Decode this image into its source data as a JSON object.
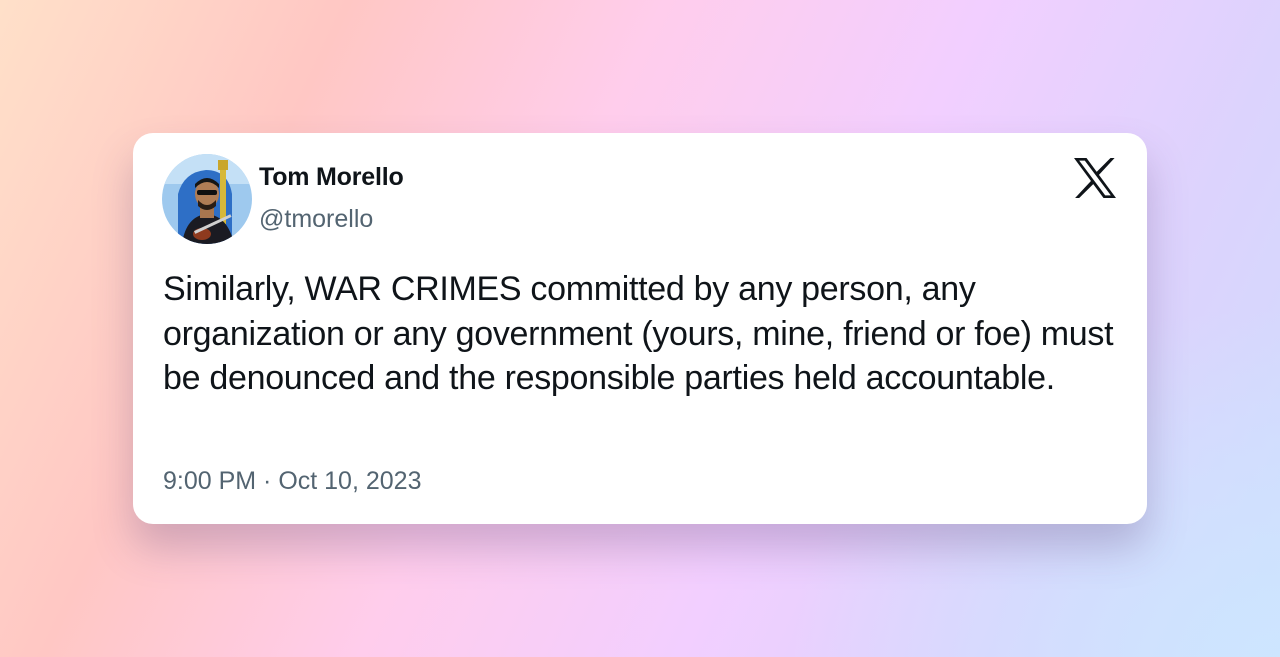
{
  "tweet": {
    "author": {
      "name": "Tom Morello",
      "handle": "@tmorello"
    },
    "text": "Similarly, WAR CRIMES committed by any person, any organization or any government (yours, mine, friend or foe) must be denounced and the responsible parties held accountable.",
    "timestamp": "9:00 PM · Oct 10, 2023"
  },
  "icons": {
    "brand": "x-logo-icon"
  },
  "colors": {
    "text_primary": "#0f1419",
    "text_secondary": "#536471",
    "card_background": "#ffffff"
  }
}
